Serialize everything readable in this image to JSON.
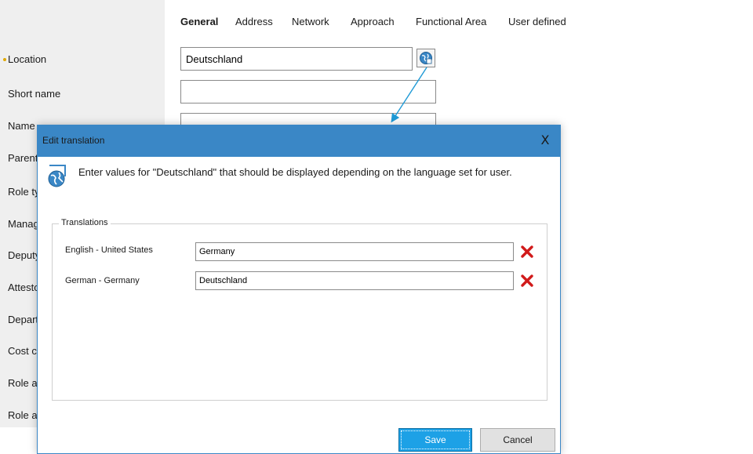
{
  "tabs": [
    {
      "label": "General",
      "active": true
    },
    {
      "label": "Address"
    },
    {
      "label": "Network"
    },
    {
      "label": "Approach"
    },
    {
      "label": "Functional Area"
    },
    {
      "label": "User defined"
    }
  ],
  "form": {
    "labels": [
      "Location",
      "Short name",
      "Name",
      "Parent",
      "Role type",
      "Manager",
      "Deputy",
      "Attestor",
      "Department",
      "Cost center",
      "Role approver",
      "Role approver"
    ],
    "location_value": "Deutschland",
    "short_name_value": "",
    "name_value": "",
    "required_marker_color": "#e0a800"
  },
  "dialog": {
    "title": "Edit translation",
    "close_symbol": "X",
    "message": "Enter values for \"Deutschland\" that should be displayed depending on the language set for user.",
    "legend": "Translations",
    "rows": [
      {
        "language": "English - United States",
        "value": "Germany"
      },
      {
        "language": "German - Germany",
        "value": "Deutschland"
      }
    ],
    "save_label": "Save",
    "cancel_label": "Cancel",
    "titlebar_color": "#3a87c6",
    "save_color": "#1da1e6",
    "delete_color": "#d11a1a"
  },
  "icons": {
    "translate_button": "globe-edit-icon",
    "dialog_icon": "globe-edit-icon",
    "delete": "delete-x-icon",
    "close": "close-icon"
  }
}
